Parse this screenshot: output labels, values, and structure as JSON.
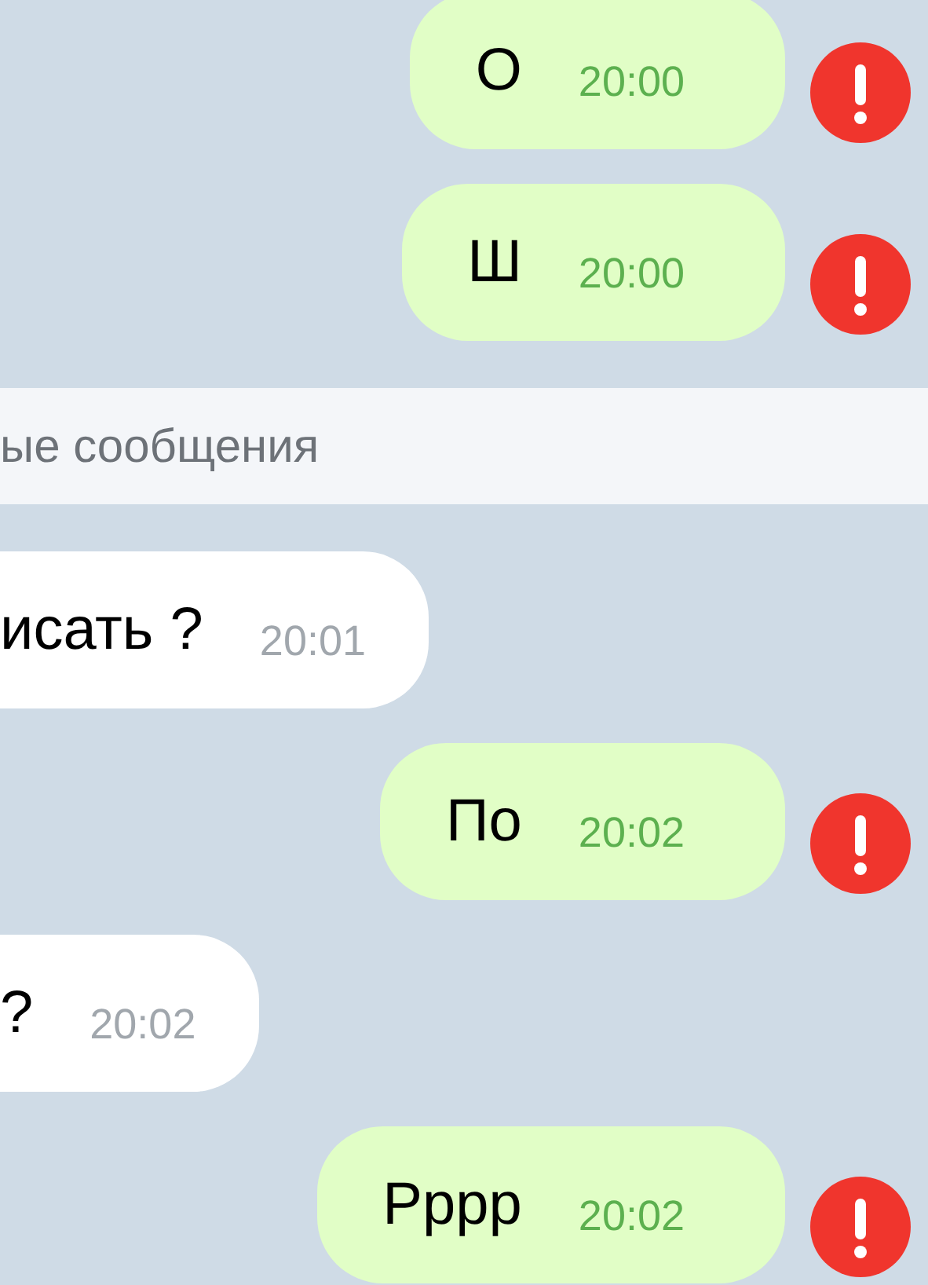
{
  "messages": [
    {
      "kind": "outgoing",
      "text": "О",
      "time": "20:00",
      "failed": true
    },
    {
      "kind": "outgoing",
      "text": "Ш",
      "time": "20:00",
      "failed": true
    },
    {
      "kind": "divider",
      "text": "ые сообщения"
    },
    {
      "kind": "incoming",
      "text": "исать ?",
      "time": "20:01"
    },
    {
      "kind": "outgoing",
      "text": "По",
      "time": "20:02",
      "failed": true
    },
    {
      "kind": "incoming",
      "text": "?",
      "time": "20:02"
    },
    {
      "kind": "outgoing",
      "text": "Рррр",
      "time": "20:02",
      "failed": true
    }
  ]
}
